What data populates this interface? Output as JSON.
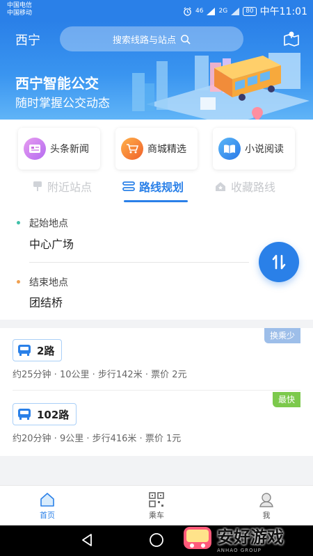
{
  "status": {
    "carrier1": "中国电信",
    "carrier2": "中国移动",
    "signal_a": "46",
    "signal_b": "2G",
    "battery": "80",
    "time": "中午11:01"
  },
  "header": {
    "city": "西宁",
    "search_placeholder": "搜索线路与站点",
    "title": "西宁智能公交",
    "subtitle": "随时掌握公交动态"
  },
  "shortcuts": [
    {
      "label": "头条新闻",
      "icon": "news-icon",
      "color": "#c86be0"
    },
    {
      "label": "商城精选",
      "icon": "cart-icon",
      "color": "#f07a2a"
    },
    {
      "label": "小说阅读",
      "icon": "book-icon",
      "color": "#2a8ae8"
    }
  ],
  "tabs": [
    {
      "label": "附近站点",
      "icon": "bus-stop-icon"
    },
    {
      "label": "路线规划",
      "icon": "route-icon"
    },
    {
      "label": "收藏路线",
      "icon": "favorite-icon"
    }
  ],
  "planner": {
    "start_label": "起始地点",
    "start_value": "中心广场",
    "end_label": "结束地点",
    "end_value": "团结桥"
  },
  "routes": [
    {
      "tag": "换乘少",
      "tag_color": "#9dbee9",
      "name": "2路",
      "info": "约25分钟 · 10公里 · 步行142米 · 票价  2元"
    },
    {
      "tag": "最快",
      "tag_color": "#7cc94c",
      "name": "102路",
      "info": "约20分钟 · 9公里 · 步行416米 · 票价  1元"
    }
  ],
  "tabbar": [
    {
      "label": "首页",
      "icon": "home-icon"
    },
    {
      "label": "乘车",
      "icon": "qr-code-icon"
    },
    {
      "label": "我",
      "icon": "profile-icon"
    }
  ],
  "watermark": {
    "text": "安好游戏",
    "small": "ANHAO GROUP"
  },
  "colors": {
    "primary": "#2a80e8",
    "orange_dot": "#f0a050",
    "teal_dot": "#3fc0a8"
  }
}
